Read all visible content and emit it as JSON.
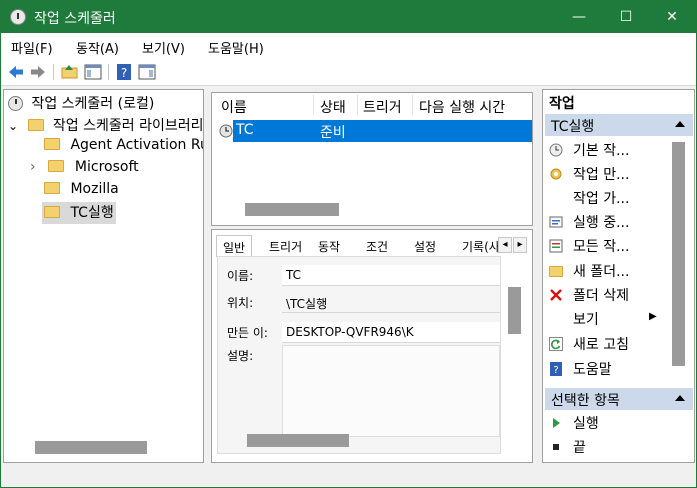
{
  "window": {
    "title": "작업 스케줄러",
    "minimize_glyph": "—",
    "maximize_glyph": "☐",
    "close_glyph": "✕"
  },
  "menu": [
    "파일(F)",
    "동작(A)",
    "보기(V)",
    "도움말(H)"
  ],
  "toolbar": {
    "icons": [
      "back-arrow-icon",
      "forward-arrow-icon",
      "folder-up-icon",
      "show-hide-console-tree-icon",
      "help-icon",
      "show-hide-action-pane-icon"
    ]
  },
  "tree": {
    "root": "작업 스케줄러 (로컬)",
    "library": "작업 스케줄러 라이브러리",
    "expand_glyph": "⌄",
    "collapsed_glyph": "›",
    "children": [
      "Agent Activation Ru",
      "Microsoft",
      "Mozilla",
      "TC실행"
    ]
  },
  "task_list": {
    "columns": [
      "이름",
      "상태",
      "트리거",
      "다음 실행 시간"
    ],
    "rows": [
      {
        "name": "TC",
        "status": "준비"
      }
    ]
  },
  "detail": {
    "tabs": [
      "일반",
      "트리거",
      "동작",
      "조건",
      "설정",
      "기록(사"
    ],
    "scroll_left_glyph": "◂",
    "scroll_right_glyph": "▸",
    "fields": {
      "name_label": "이름:",
      "name_value": "TC",
      "location_label": "위치:",
      "location_value": "\\TC실행",
      "author_label": "만든 이:",
      "author_value": "DESKTOP-QVFR946\\K",
      "description_label": "설명:"
    }
  },
  "actions": {
    "header": "작업",
    "section1": "TC실행",
    "items1": [
      "기본 작...",
      "작업 만...",
      "작업 가...",
      "실행 중...",
      "모든 작...",
      "새 폴더...",
      "폴더 삭제",
      "보기",
      "새로 고침",
      "도움말"
    ],
    "view_submenu_glyph": "▶",
    "section2": "선택한 항목",
    "items2": [
      "실행",
      "끝"
    ]
  },
  "colors": {
    "titlebar": "#1e7b3b",
    "selection": "#0078d7",
    "section_bg": "#ccd9ea"
  }
}
